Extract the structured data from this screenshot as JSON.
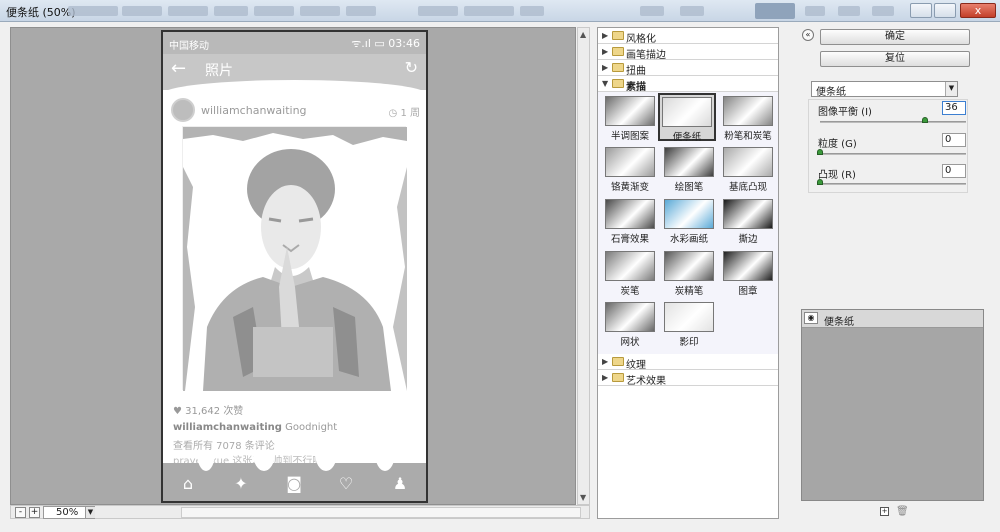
{
  "window": {
    "title": "便条纸 (50%)",
    "close_label": "x"
  },
  "canvas": {
    "zoom": "50%",
    "zoom_out": "-",
    "zoom_in": "+"
  },
  "phone": {
    "carrier": "中国移动",
    "status_right": "ᯤ.ıl ▭ 03:46",
    "header_title": "照片",
    "back_icon": "←",
    "refresh_icon": "↻",
    "username": "williamchanwaiting",
    "time_ago": "◷ 1 周",
    "likes": "♥ 31,642 次赞",
    "caption_user": "williamchanwaiting",
    "caption_text": " Goodnight",
    "comments_link": "查看所有 7078 条评论",
    "comment_1": "prayer_xue 这张真的帅到不行啊"
  },
  "gallery": {
    "categories_top": [
      "风格化",
      "画笔描边",
      "扭曲"
    ],
    "sketch_label": "素描",
    "thumbnails": [
      {
        "label": "半调图案",
        "selected": false,
        "tone": "#6c6c6c"
      },
      {
        "label": "便条纸",
        "selected": true,
        "tone": "#d9d9d9"
      },
      {
        "label": "粉笔和炭笔",
        "selected": false,
        "tone": "#858585"
      },
      {
        "label": "铬黄渐变",
        "selected": false,
        "tone": "#9a9a9a"
      },
      {
        "label": "绘图笔",
        "selected": false,
        "tone": "#3d3d3d"
      },
      {
        "label": "基底凸现",
        "selected": false,
        "tone": "#aaaaaa"
      },
      {
        "label": "石膏效果",
        "selected": false,
        "tone": "#4a4a4a"
      },
      {
        "label": "水彩画纸",
        "selected": false,
        "tone": "#5aa9d6"
      },
      {
        "label": "撕边",
        "selected": false,
        "tone": "#1a1a1a"
      },
      {
        "label": "炭笔",
        "selected": false,
        "tone": "#7a7a7a"
      },
      {
        "label": "炭精笔",
        "selected": false,
        "tone": "#555555"
      },
      {
        "label": "图章",
        "selected": false,
        "tone": "#202020"
      },
      {
        "label": "网状",
        "selected": false,
        "tone": "#666666"
      },
      {
        "label": "影印",
        "selected": false,
        "tone": "#e2e2e2"
      }
    ],
    "categories_bottom": [
      "纹理",
      "艺术效果"
    ]
  },
  "controls": {
    "ok": "确定",
    "reset": "复位",
    "filter_name": "便条纸",
    "params": [
      {
        "label": "图像平衡 (I)",
        "value": "36",
        "level": 0.72
      },
      {
        "label": "粒度 (G)",
        "value": "0",
        "level": 0
      },
      {
        "label": "凸现 (R)",
        "value": "0",
        "level": 0
      }
    ]
  },
  "layers": {
    "row_name": "便条纸"
  }
}
